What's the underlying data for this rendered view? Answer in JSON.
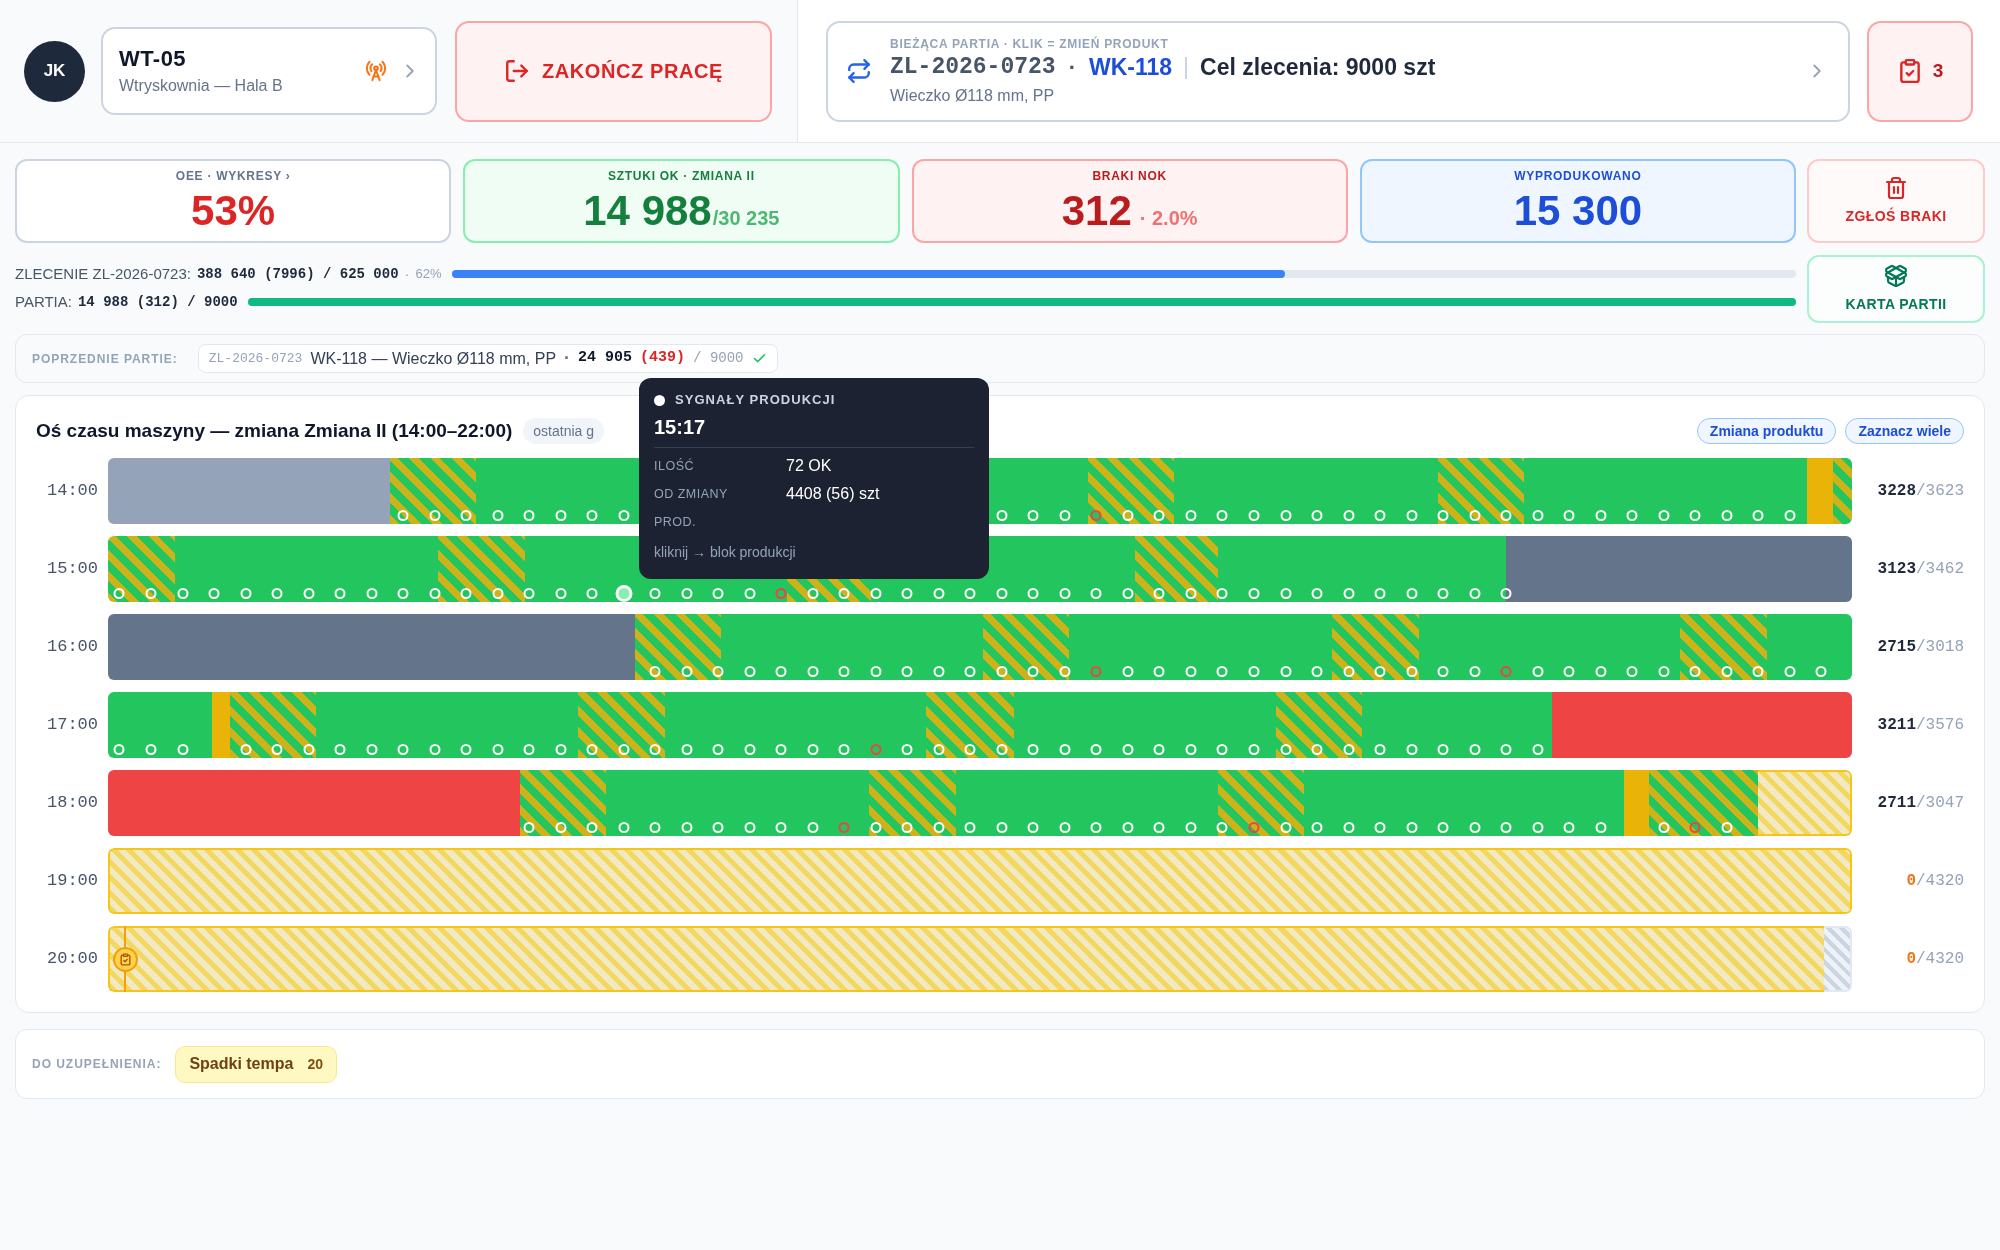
{
  "header": {
    "operator": {
      "initials": "JK"
    },
    "machine": {
      "code": "WT-05",
      "location": "Wtryskownia — Hala B"
    },
    "finish_button": "ZAKOŃCZ PRACĘ",
    "batch": {
      "label": "BIEŻĄCA PARTIA · KLIK = ZMIEŃ PRODUKT",
      "order": "ZL-2026-0723",
      "separator": "·",
      "product": "WK-118",
      "goal": "Cel zlecenia: 9000 szt",
      "description": "Wieczko Ø118 mm, PP"
    },
    "tasks": {
      "count": "3"
    }
  },
  "kpis": [
    {
      "kind": "oee",
      "label": "OEE · WYKRESY ›",
      "value": "53%"
    },
    {
      "kind": "ok",
      "label": "SZTUKI OK · ZMIANA II",
      "value": "14 988",
      "suffix": "/30 235"
    },
    {
      "kind": "nok",
      "label": "BRAKI NOK",
      "value": "312",
      "suffix": "· 2.0%"
    },
    {
      "kind": "output",
      "label": "WYPRODUKOWANO",
      "value": "15 300"
    }
  ],
  "actions": [
    {
      "kind": "report",
      "label": "ZGŁOŚ BRAKI"
    },
    {
      "kind": "card",
      "label": "KARTA PARTII"
    }
  ],
  "progress": [
    {
      "kind": "order",
      "label": "ZLECENIE ZL-2026-0723:",
      "value": "388 640 (7996) / 625 000",
      "separator": "·",
      "percent": "62%",
      "level": 0.62
    },
    {
      "kind": "batch",
      "label": "PARTIA:",
      "value": "14 988 (312) / 9000",
      "level": 1
    }
  ],
  "previous_batches": {
    "label": "POPRZEDNIE PARTIE:",
    "items": [
      {
        "order": "ZL-2026-0723",
        "product": "WK-118 — Wieczko Ø118 mm, PP",
        "separator": "·",
        "ok": "24 905",
        "nok": "(439)",
        "target": "/ 9000",
        "completed": true
      }
    ]
  },
  "timeline": {
    "title": "Oś czasu maszyny — zmiana Zmiana II (14:00–22:00)",
    "view_chips": [
      {
        "label": "ostatnia g"
      }
    ],
    "buttons": [
      "Zmiana produktu",
      "Zaznacz wiele"
    ],
    "rows": [
      {
        "hour": "14:00",
        "ok": "3228",
        "target": "/3623",
        "empty": false,
        "segments": [
          {
            "kind": "idle"
          },
          {
            "kind": "slow",
            "signals": [
              {
                "kind": "ok",
                "selected": false
              },
              {
                "kind": "ok",
                "selected": false
              },
              {
                "kind": "ok",
                "selected": false
              }
            ]
          },
          {
            "kind": "run",
            "signals": [
              {
                "kind": "ok",
                "selected": false
              },
              {
                "kind": "ok",
                "selected": false
              },
              {
                "kind": "ok",
                "selected": false
              },
              {
                "kind": "ok",
                "selected": false
              },
              {
                "kind": "ok",
                "selected": false
              }
            ]
          },
          {
            "kind": "run",
            "signals": [
              {
                "kind": "ok",
                "selected": false
              },
              {
                "kind": "ok",
                "selected": false
              },
              {
                "kind": "ok",
                "selected": false
              }
            ]
          },
          {
            "kind": "slow",
            "signals": [
              {
                "kind": "nok",
                "selected": false
              },
              {
                "kind": "ok",
                "selected": false
              },
              {
                "kind": "ok",
                "selected": false
              }
            ]
          },
          {
            "kind": "run",
            "signals": [
              {
                "kind": "ok",
                "selected": false
              },
              {
                "kind": "ok",
                "selected": false
              },
              {
                "kind": "ok",
                "selected": false
              },
              {
                "kind": "ok",
                "selected": false
              },
              {
                "kind": "ok",
                "selected": false
              },
              {
                "kind": "ok",
                "selected": false
              },
              {
                "kind": "ok",
                "selected": false
              },
              {
                "kind": "ok",
                "selected": false
              }
            ]
          },
          {
            "kind": "slow",
            "signals": [
              {
                "kind": "ok",
                "selected": false
              },
              {
                "kind": "ok",
                "selected": false
              },
              {
                "kind": "ok",
                "selected": false
              }
            ]
          },
          {
            "kind": "run",
            "signals": [
              {
                "kind": "ok",
                "selected": false
              },
              {
                "kind": "ok",
                "selected": false
              },
              {
                "kind": "ok",
                "selected": false
              },
              {
                "kind": "ok",
                "selected": false
              },
              {
                "kind": "ok",
                "selected": false
              },
              {
                "kind": "ok",
                "selected": false
              },
              {
                "kind": "ok",
                "selected": false
              },
              {
                "kind": "ok",
                "selected": false
              },
              {
                "kind": "ok",
                "selected": false
              }
            ]
          },
          {
            "kind": "micro"
          },
          {
            "kind": "slow"
          }
        ]
      },
      {
        "hour": "15:00",
        "ok": "3123",
        "target": "/3462",
        "empty": false,
        "segments": [
          {
            "kind": "slow",
            "signals": [
              {
                "kind": "ok",
                "selected": false
              },
              {
                "kind": "ok",
                "selected": false
              }
            ]
          },
          {
            "kind": "run",
            "signals": [
              {
                "kind": "ok",
                "selected": false
              },
              {
                "kind": "ok",
                "selected": false
              },
              {
                "kind": "ok",
                "selected": false
              },
              {
                "kind": "ok",
                "selected": false
              },
              {
                "kind": "ok",
                "selected": false
              },
              {
                "kind": "ok",
                "selected": false
              },
              {
                "kind": "ok",
                "selected": false
              },
              {
                "kind": "ok",
                "selected": false
              },
              {
                "kind": "ok",
                "selected": false
              }
            ]
          },
          {
            "kind": "slow",
            "signals": [
              {
                "kind": "ok",
                "selected": false
              },
              {
                "kind": "ok",
                "selected": false
              }
            ]
          },
          {
            "kind": "run",
            "signals": [
              {
                "kind": "ok",
                "selected": false
              },
              {
                "kind": "ok",
                "selected": false
              },
              {
                "kind": "ok",
                "selected": false
              },
              {
                "kind": "ok",
                "selected": true
              },
              {
                "kind": "ok",
                "selected": false
              },
              {
                "kind": "ok",
                "selected": false
              },
              {
                "kind": "ok",
                "selected": false
              },
              {
                "kind": "ok",
                "selected": false
              },
              {
                "kind": "nok",
                "selected": false
              }
            ]
          },
          {
            "kind": "slow",
            "signals": [
              {
                "kind": "ok",
                "selected": false
              },
              {
                "kind": "ok",
                "selected": false
              }
            ]
          },
          {
            "kind": "run",
            "signals": [
              {
                "kind": "ok",
                "selected": false
              },
              {
                "kind": "ok",
                "selected": false
              },
              {
                "kind": "ok",
                "selected": false
              },
              {
                "kind": "ok",
                "selected": false
              },
              {
                "kind": "ok",
                "selected": false
              },
              {
                "kind": "ok",
                "selected": false
              },
              {
                "kind": "ok",
                "selected": false
              },
              {
                "kind": "ok",
                "selected": false
              },
              {
                "kind": "ok",
                "selected": false
              }
            ]
          },
          {
            "kind": "slow",
            "signals": [
              {
                "kind": "ok",
                "selected": false
              },
              {
                "kind": "ok",
                "selected": false
              }
            ]
          },
          {
            "kind": "run",
            "signals": [
              {
                "kind": "ok",
                "selected": false
              },
              {
                "kind": "ok",
                "selected": false
              },
              {
                "kind": "ok",
                "selected": false
              },
              {
                "kind": "ok",
                "selected": false
              },
              {
                "kind": "ok",
                "selected": false
              },
              {
                "kind": "ok",
                "selected": false
              },
              {
                "kind": "ok",
                "selected": false
              },
              {
                "kind": "ok",
                "selected": false
              },
              {
                "kind": "ok",
                "selected": false
              },
              {
                "kind": "ok",
                "selected": false
              }
            ]
          },
          {
            "kind": "setup"
          }
        ]
      },
      {
        "hour": "16:00",
        "ok": "2715",
        "target": "/3018",
        "empty": false,
        "segments": [
          {
            "kind": "setup"
          },
          {
            "kind": "slow",
            "signals": [
              {
                "kind": "ok",
                "selected": false
              },
              {
                "kind": "ok",
                "selected": false
              },
              {
                "kind": "ok",
                "selected": false
              }
            ]
          },
          {
            "kind": "run",
            "signals": [
              {
                "kind": "ok",
                "selected": false
              },
              {
                "kind": "ok",
                "selected": false
              },
              {
                "kind": "ok",
                "selected": false
              },
              {
                "kind": "ok",
                "selected": false
              },
              {
                "kind": "ok",
                "selected": false
              },
              {
                "kind": "ok",
                "selected": false
              },
              {
                "kind": "ok",
                "selected": false
              },
              {
                "kind": "ok",
                "selected": false
              }
            ]
          },
          {
            "kind": "slow",
            "signals": [
              {
                "kind": "ok",
                "selected": false
              },
              {
                "kind": "ok",
                "selected": false
              },
              {
                "kind": "ok",
                "selected": false
              }
            ]
          },
          {
            "kind": "run",
            "signals": [
              {
                "kind": "nok",
                "selected": false
              },
              {
                "kind": "ok",
                "selected": false
              },
              {
                "kind": "ok",
                "selected": false
              },
              {
                "kind": "ok",
                "selected": false
              },
              {
                "kind": "ok",
                "selected": false
              },
              {
                "kind": "ok",
                "selected": false
              },
              {
                "kind": "ok",
                "selected": false
              },
              {
                "kind": "ok",
                "selected": false
              }
            ]
          },
          {
            "kind": "slow",
            "signals": [
              {
                "kind": "ok",
                "selected": false
              },
              {
                "kind": "ok",
                "selected": false
              },
              {
                "kind": "ok",
                "selected": false
              }
            ]
          },
          {
            "kind": "run",
            "signals": [
              {
                "kind": "ok",
                "selected": false
              },
              {
                "kind": "ok",
                "selected": false
              },
              {
                "kind": "nok",
                "selected": false
              },
              {
                "kind": "ok",
                "selected": false
              },
              {
                "kind": "ok",
                "selected": false
              },
              {
                "kind": "ok",
                "selected": false
              },
              {
                "kind": "ok",
                "selected": false
              },
              {
                "kind": "ok",
                "selected": false
              }
            ]
          },
          {
            "kind": "slow",
            "signals": [
              {
                "kind": "ok",
                "selected": false
              },
              {
                "kind": "ok",
                "selected": false
              },
              {
                "kind": "ok",
                "selected": false
              }
            ]
          },
          {
            "kind": "run",
            "signals": [
              {
                "kind": "ok",
                "selected": false
              },
              {
                "kind": "ok",
                "selected": false
              }
            ]
          }
        ]
      },
      {
        "hour": "17:00",
        "ok": "3211",
        "target": "/3576",
        "empty": false,
        "segments": [
          {
            "kind": "run",
            "signals": [
              {
                "kind": "ok",
                "selected": false
              },
              {
                "kind": "ok",
                "selected": false
              },
              {
                "kind": "ok",
                "selected": false
              }
            ]
          },
          {
            "kind": "micro"
          },
          {
            "kind": "slow",
            "signals": [
              {
                "kind": "ok",
                "selected": false
              },
              {
                "kind": "ok",
                "selected": false
              },
              {
                "kind": "ok",
                "selected": false
              }
            ]
          },
          {
            "kind": "run",
            "signals": [
              {
                "kind": "ok",
                "selected": false
              },
              {
                "kind": "ok",
                "selected": false
              },
              {
                "kind": "ok",
                "selected": false
              },
              {
                "kind": "ok",
                "selected": false
              },
              {
                "kind": "ok",
                "selected": false
              },
              {
                "kind": "ok",
                "selected": false
              },
              {
                "kind": "ok",
                "selected": false
              },
              {
                "kind": "ok",
                "selected": false
              }
            ]
          },
          {
            "kind": "slow",
            "signals": [
              {
                "kind": "ok",
                "selected": false
              },
              {
                "kind": "ok",
                "selected": false
              },
              {
                "kind": "ok",
                "selected": false
              }
            ]
          },
          {
            "kind": "run",
            "signals": [
              {
                "kind": "ok",
                "selected": false
              },
              {
                "kind": "ok",
                "selected": false
              },
              {
                "kind": "ok",
                "selected": false
              },
              {
                "kind": "ok",
                "selected": false
              },
              {
                "kind": "ok",
                "selected": false
              },
              {
                "kind": "ok",
                "selected": false
              },
              {
                "kind": "nok",
                "selected": false
              },
              {
                "kind": "ok",
                "selected": false
              }
            ]
          },
          {
            "kind": "slow",
            "signals": [
              {
                "kind": "ok",
                "selected": false
              },
              {
                "kind": "ok",
                "selected": false
              },
              {
                "kind": "ok",
                "selected": false
              }
            ]
          },
          {
            "kind": "run",
            "signals": [
              {
                "kind": "ok",
                "selected": false
              },
              {
                "kind": "ok",
                "selected": false
              },
              {
                "kind": "ok",
                "selected": false
              },
              {
                "kind": "ok",
                "selected": false
              },
              {
                "kind": "ok",
                "selected": false
              },
              {
                "kind": "ok",
                "selected": false
              },
              {
                "kind": "ok",
                "selected": false
              },
              {
                "kind": "ok",
                "selected": false
              }
            ]
          },
          {
            "kind": "slow",
            "signals": [
              {
                "kind": "ok",
                "selected": false
              },
              {
                "kind": "ok",
                "selected": false
              },
              {
                "kind": "ok",
                "selected": false
              }
            ]
          },
          {
            "kind": "run",
            "signals": [
              {
                "kind": "ok",
                "selected": false
              },
              {
                "kind": "ok",
                "selected": false
              },
              {
                "kind": "ok",
                "selected": false
              },
              {
                "kind": "ok",
                "selected": false
              },
              {
                "kind": "ok",
                "selected": false
              },
              {
                "kind": "ok",
                "selected": false
              }
            ]
          },
          {
            "kind": "stop"
          }
        ]
      },
      {
        "hour": "18:00",
        "ok": "2711",
        "target": "/3047",
        "empty": false,
        "segments": [
          {
            "kind": "stop"
          },
          {
            "kind": "slow",
            "signals": [
              {
                "kind": "ok",
                "selected": false
              },
              {
                "kind": "ok",
                "selected": false
              },
              {
                "kind": "ok",
                "selected": false
              }
            ]
          },
          {
            "kind": "run",
            "signals": [
              {
                "kind": "ok",
                "selected": false
              },
              {
                "kind": "ok",
                "selected": false
              },
              {
                "kind": "ok",
                "selected": false
              },
              {
                "kind": "ok",
                "selected": false
              },
              {
                "kind": "ok",
                "selected": false
              },
              {
                "kind": "ok",
                "selected": false
              },
              {
                "kind": "ok",
                "selected": false
              },
              {
                "kind": "nok",
                "selected": false
              }
            ]
          },
          {
            "kind": "slow",
            "signals": [
              {
                "kind": "ok",
                "selected": false
              },
              {
                "kind": "ok",
                "selected": false
              },
              {
                "kind": "ok",
                "selected": false
              }
            ]
          },
          {
            "kind": "run",
            "signals": [
              {
                "kind": "ok",
                "selected": false
              },
              {
                "kind": "ok",
                "selected": false
              },
              {
                "kind": "ok",
                "selected": false
              },
              {
                "kind": "ok",
                "selected": false
              },
              {
                "kind": "ok",
                "selected": false
              },
              {
                "kind": "ok",
                "selected": false
              },
              {
                "kind": "ok",
                "selected": false
              },
              {
                "kind": "ok",
                "selected": false
              }
            ]
          },
          {
            "kind": "slow",
            "signals": [
              {
                "kind": "ok",
                "selected": false
              },
              {
                "kind": "nok",
                "selected": false
              },
              {
                "kind": "ok",
                "selected": false
              }
            ]
          },
          {
            "kind": "run",
            "signals": [
              {
                "kind": "ok",
                "selected": false
              },
              {
                "kind": "ok",
                "selected": false
              },
              {
                "kind": "ok",
                "selected": false
              },
              {
                "kind": "ok",
                "selected": false
              },
              {
                "kind": "ok",
                "selected": false
              },
              {
                "kind": "ok",
                "selected": false
              },
              {
                "kind": "ok",
                "selected": false
              },
              {
                "kind": "ok",
                "selected": false
              },
              {
                "kind": "ok",
                "selected": false
              },
              {
                "kind": "ok",
                "selected": false
              }
            ]
          },
          {
            "kind": "micro"
          },
          {
            "kind": "slow",
            "signals": [
              {
                "kind": "ok",
                "selected": false
              },
              {
                "kind": "nok",
                "selected": false
              },
              {
                "kind": "ok",
                "selected": false
              }
            ]
          },
          {
            "kind": "planned"
          }
        ]
      },
      {
        "hour": "19:00",
        "ok": "0",
        "target": "/4320",
        "empty": true,
        "segments": [
          {
            "kind": "planned"
          }
        ]
      },
      {
        "hour": "20:00",
        "ok": "0",
        "target": "/4320",
        "empty": true,
        "marker": {
          "kind": "checklist"
        },
        "segments": [
          {
            "kind": "planned"
          },
          {
            "kind": "offshift"
          }
        ]
      }
    ]
  },
  "tooltip": {
    "title": "SYGNAŁY PRODUKCJI",
    "time": "15:17",
    "fields": [
      {
        "label": "ILOŚĆ",
        "value": "72 OK"
      },
      {
        "label": "OD ZMIANY",
        "value": "4408 (56) szt"
      },
      {
        "label": "PROD."
      }
    ],
    "hint": "kliknij → blok produkcji"
  },
  "to_complete": {
    "label": "DO UZUPEŁNIENIA:",
    "items": [
      {
        "label": "Spadki tempa",
        "count": "20"
      }
    ]
  }
}
